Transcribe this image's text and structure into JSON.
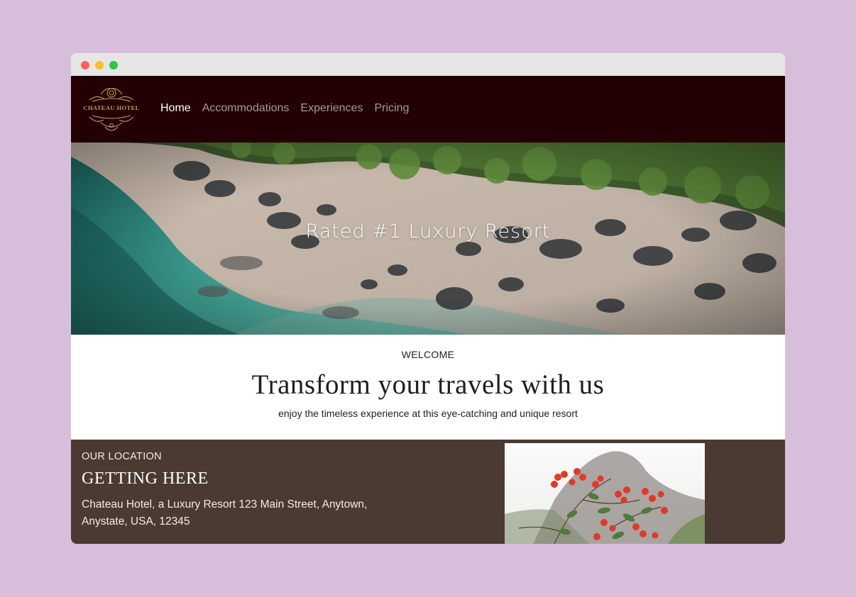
{
  "brand": {
    "name": "CHATEAU HOTEL",
    "accent": "#c89b5c",
    "nav_bg": "#220003"
  },
  "nav": {
    "items": [
      {
        "label": "Home",
        "active": true
      },
      {
        "label": "Accommodations",
        "active": false
      },
      {
        "label": "Experiences",
        "active": false
      },
      {
        "label": "Pricing",
        "active": false
      }
    ]
  },
  "hero": {
    "title": "Rated #1 Luxury Resort"
  },
  "welcome": {
    "eyebrow": "WELCOME",
    "title": "Transform your travels with us",
    "subtitle": "enjoy the timeless experience at this eye-catching and unique resort"
  },
  "location": {
    "eyebrow": "OUR LOCATION",
    "title": "GETTING HERE",
    "address": "Chateau Hotel, a Luxury Resort 123 Main Street, Anytown, Anystate, USA, 12345",
    "bg": "#4a3a31"
  }
}
